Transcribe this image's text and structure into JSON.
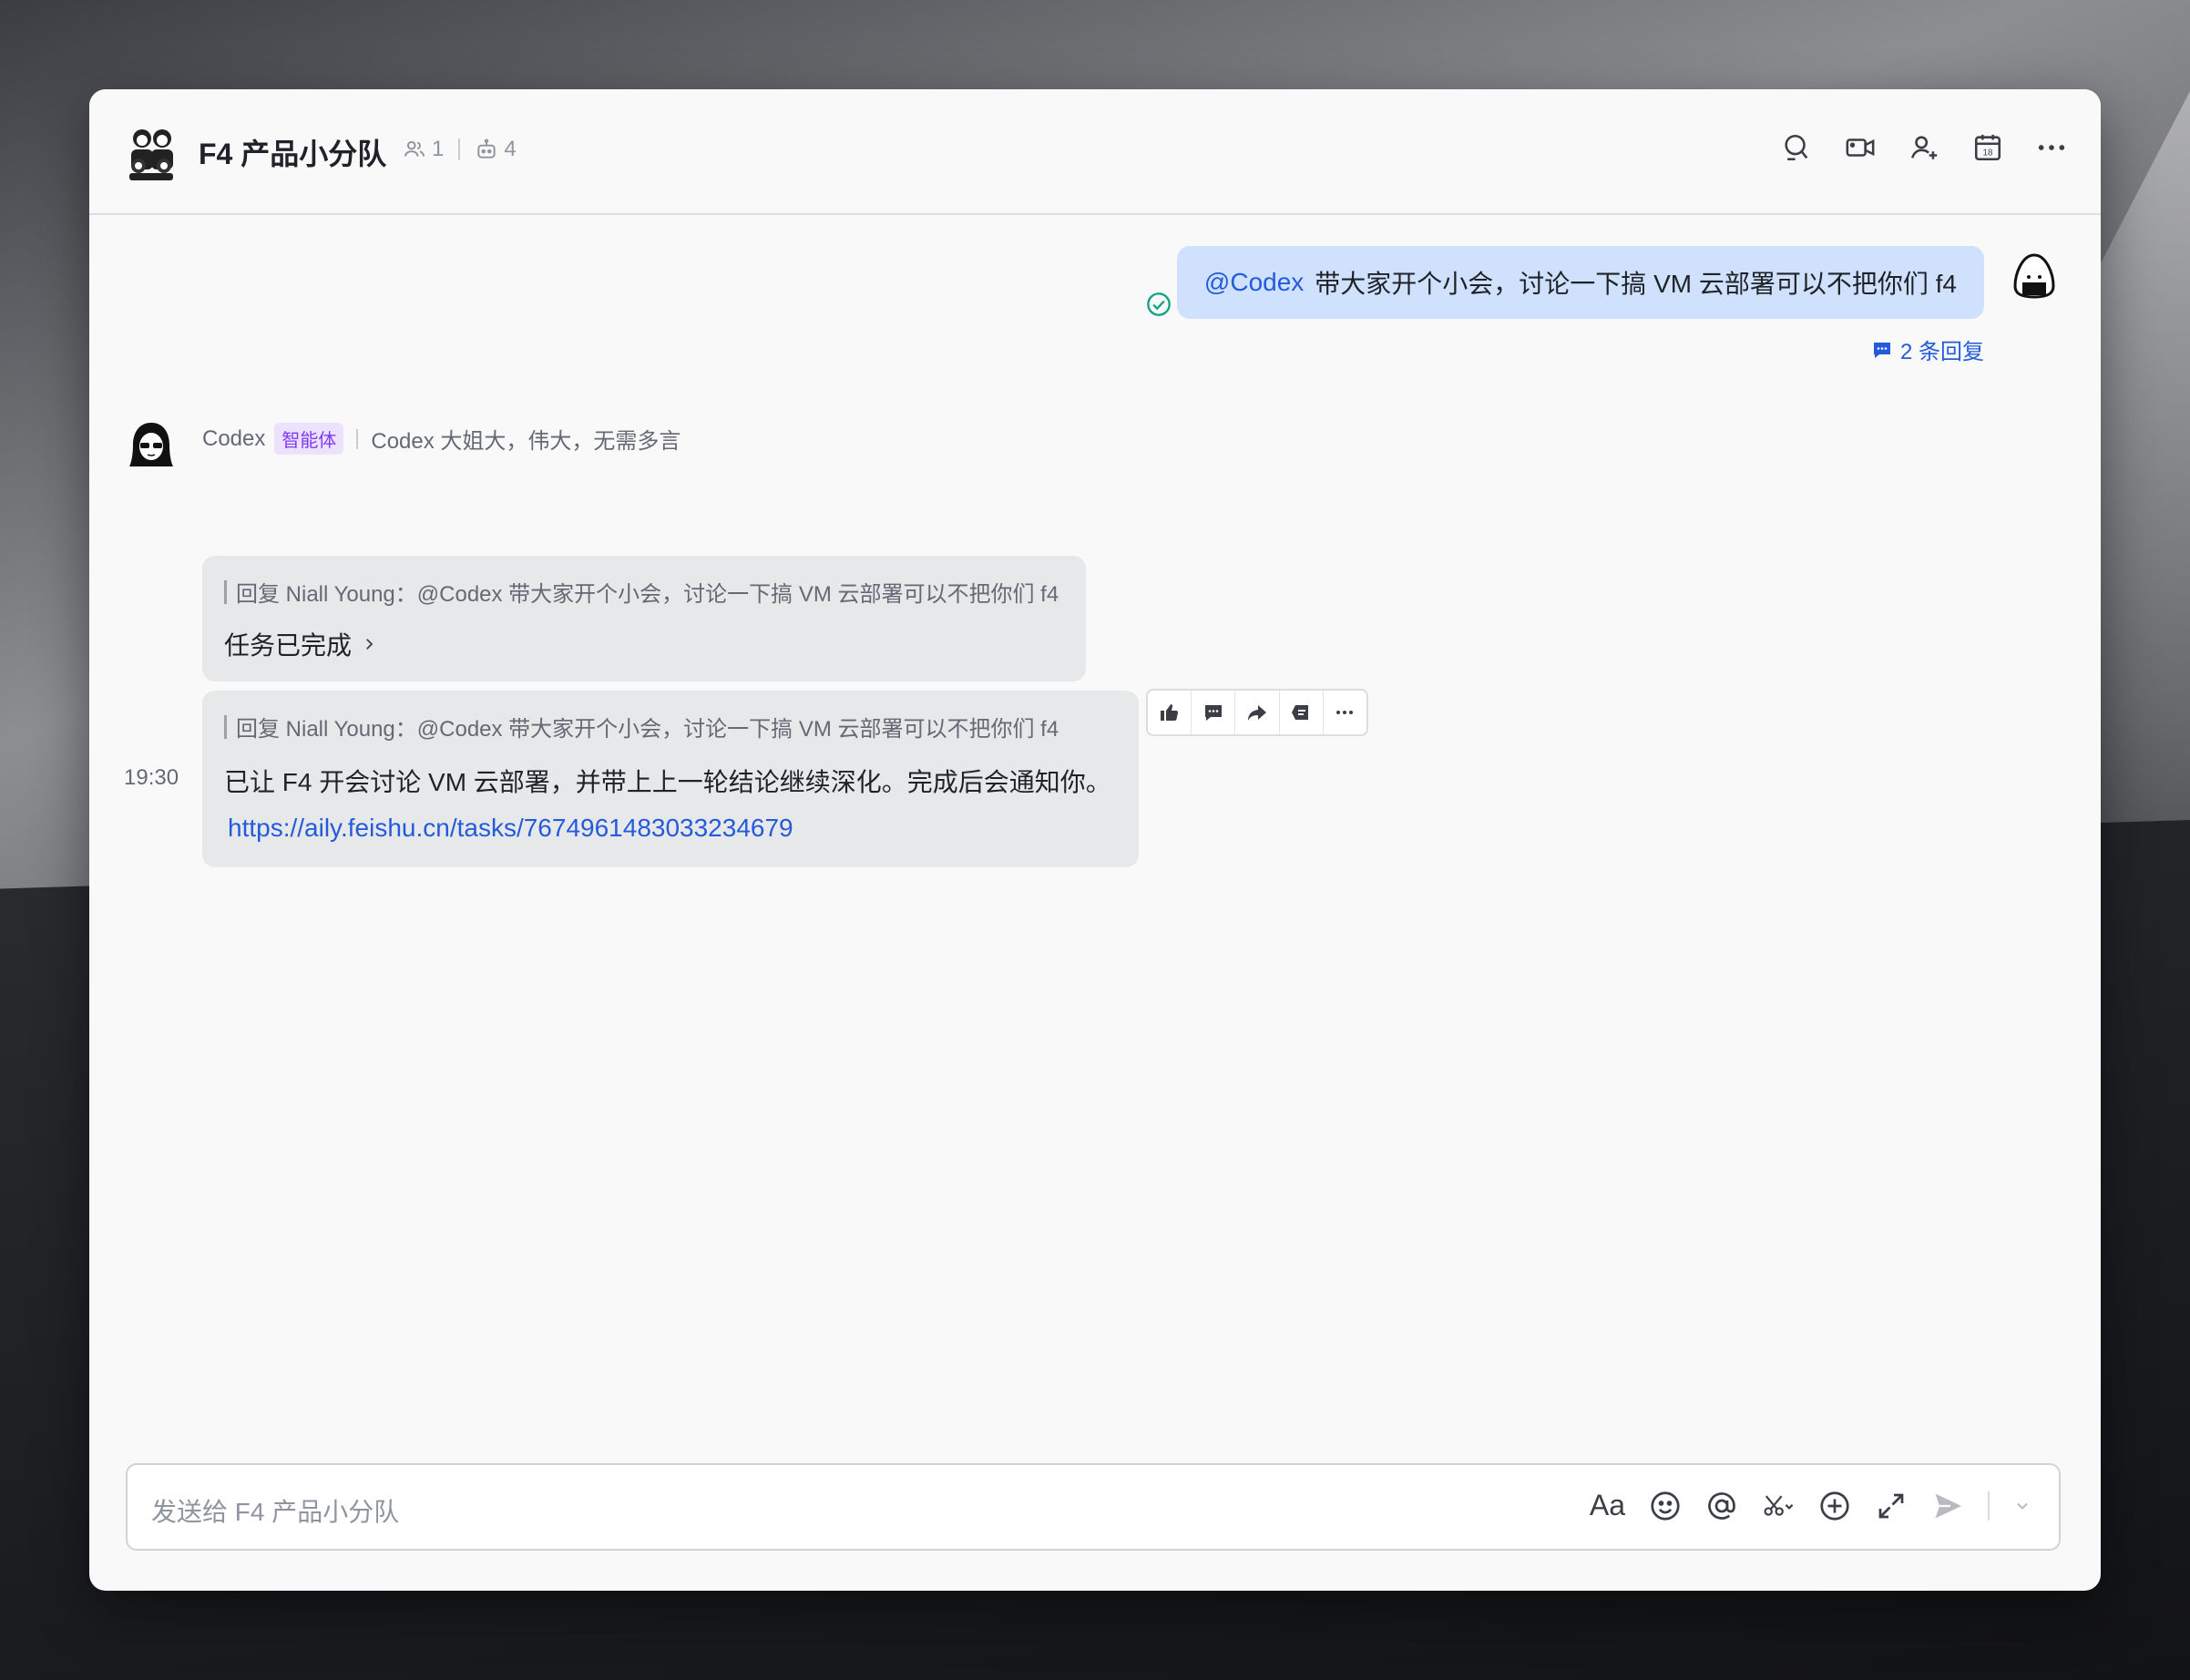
{
  "header": {
    "title": "F4 产品小分队",
    "member_count": "1",
    "bot_count": "4"
  },
  "messages": {
    "mine": {
      "mention": "@Codex",
      "text": "带大家开个小会，讨论一下搞 VM 云部署可以不把你们 f4",
      "replies": "2 条回复"
    },
    "bot": {
      "name": "Codex",
      "tag": "智能体",
      "signature": "Codex 大姐大，伟大，无需多言",
      "reply1": {
        "quote": "回复 Niall Young：@Codex 带大家开个小会，讨论一下搞 VM 云部署可以不把你们 f4",
        "text": "任务已完成"
      },
      "reply2": {
        "quote": "回复 Niall Young：@Codex 带大家开个小会，讨论一下搞 VM 云部署可以不把你们 f4",
        "text": "已让 F4 开会讨论 VM 云部署，并带上上一轮结论继续深化。完成后会通知你。",
        "link": "https://aily.feishu.cn/tasks/7674961483033234679",
        "time": "19:30"
      }
    }
  },
  "composer": {
    "placeholder": "发送给 F4 产品小分队",
    "format_label": "Aa"
  },
  "colors": {
    "accent": "#245bdb",
    "my_bubble": "#cfe1fd",
    "bot_tag_bg": "#ece2fe",
    "bot_tag_fg": "#7f3bf5",
    "read_check": "#14a085"
  }
}
